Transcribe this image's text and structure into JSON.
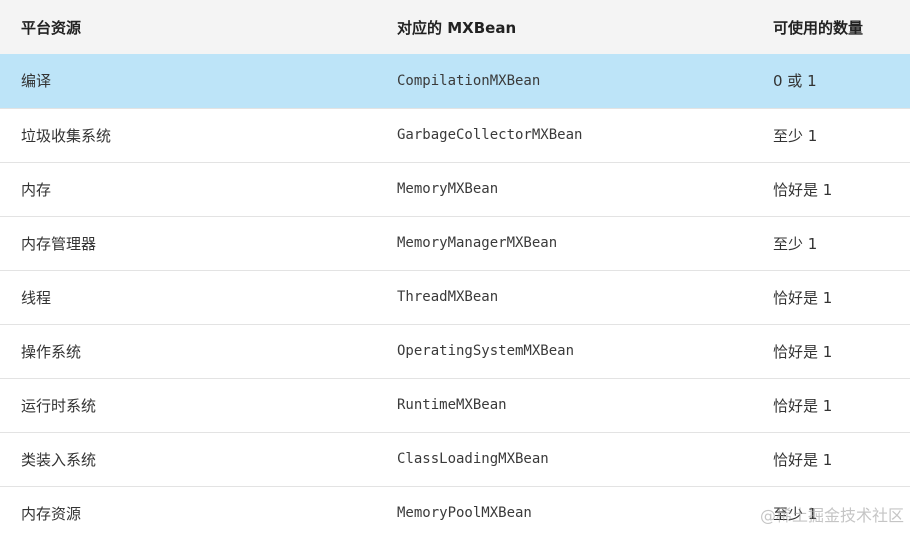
{
  "table": {
    "headers": [
      "平台资源",
      "对应的 MXBean",
      "可使用的数量"
    ],
    "rows": [
      [
        "编译",
        "CompilationMXBean",
        "0 或 1"
      ],
      [
        "垃圾收集系统",
        "GarbageCollectorMXBean",
        "至少 1"
      ],
      [
        "内存",
        "MemoryMXBean",
        "恰好是 1"
      ],
      [
        "内存管理器",
        "MemoryManagerMXBean",
        "至少 1"
      ],
      [
        "线程",
        "ThreadMXBean",
        "恰好是 1"
      ],
      [
        "操作系统",
        "OperatingSystemMXBean",
        "恰好是 1"
      ],
      [
        "运行时系统",
        "RuntimeMXBean",
        "恰好是 1"
      ],
      [
        "类装入系统",
        "ClassLoadingMXBean",
        "恰好是 1"
      ],
      [
        "内存资源",
        "MemoryPoolMXBean",
        "至少 1"
      ]
    ],
    "selected_row": 0
  },
  "watermark": "@稀土掘金技术社区"
}
